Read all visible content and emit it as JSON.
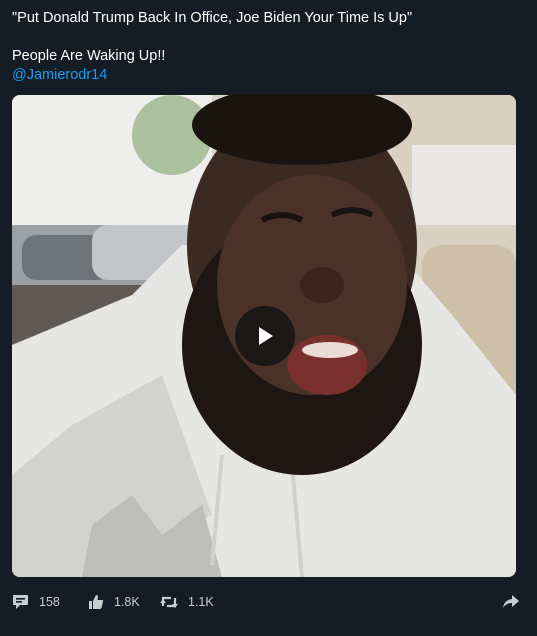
{
  "post": {
    "title_line": "\"Put Donald Trump Back In Office, Joe Biden Your Time Is Up\"",
    "body_line": "People Are Waking Up!!",
    "mention": "@Jamierodr14"
  },
  "video": {
    "play_icon": "play-icon"
  },
  "actions": {
    "reply": {
      "icon": "comment-icon",
      "count": "158"
    },
    "like": {
      "icon": "thumbs-up-icon",
      "count": "1.8K"
    },
    "retweet": {
      "icon": "retweet-icon",
      "count": "1.1K"
    },
    "share": {
      "icon": "share-arrow-icon"
    }
  },
  "colors": {
    "background": "#141d26",
    "text": "#ffffff",
    "mention": "#1d9bf0",
    "action_text": "#c7ccd1"
  }
}
